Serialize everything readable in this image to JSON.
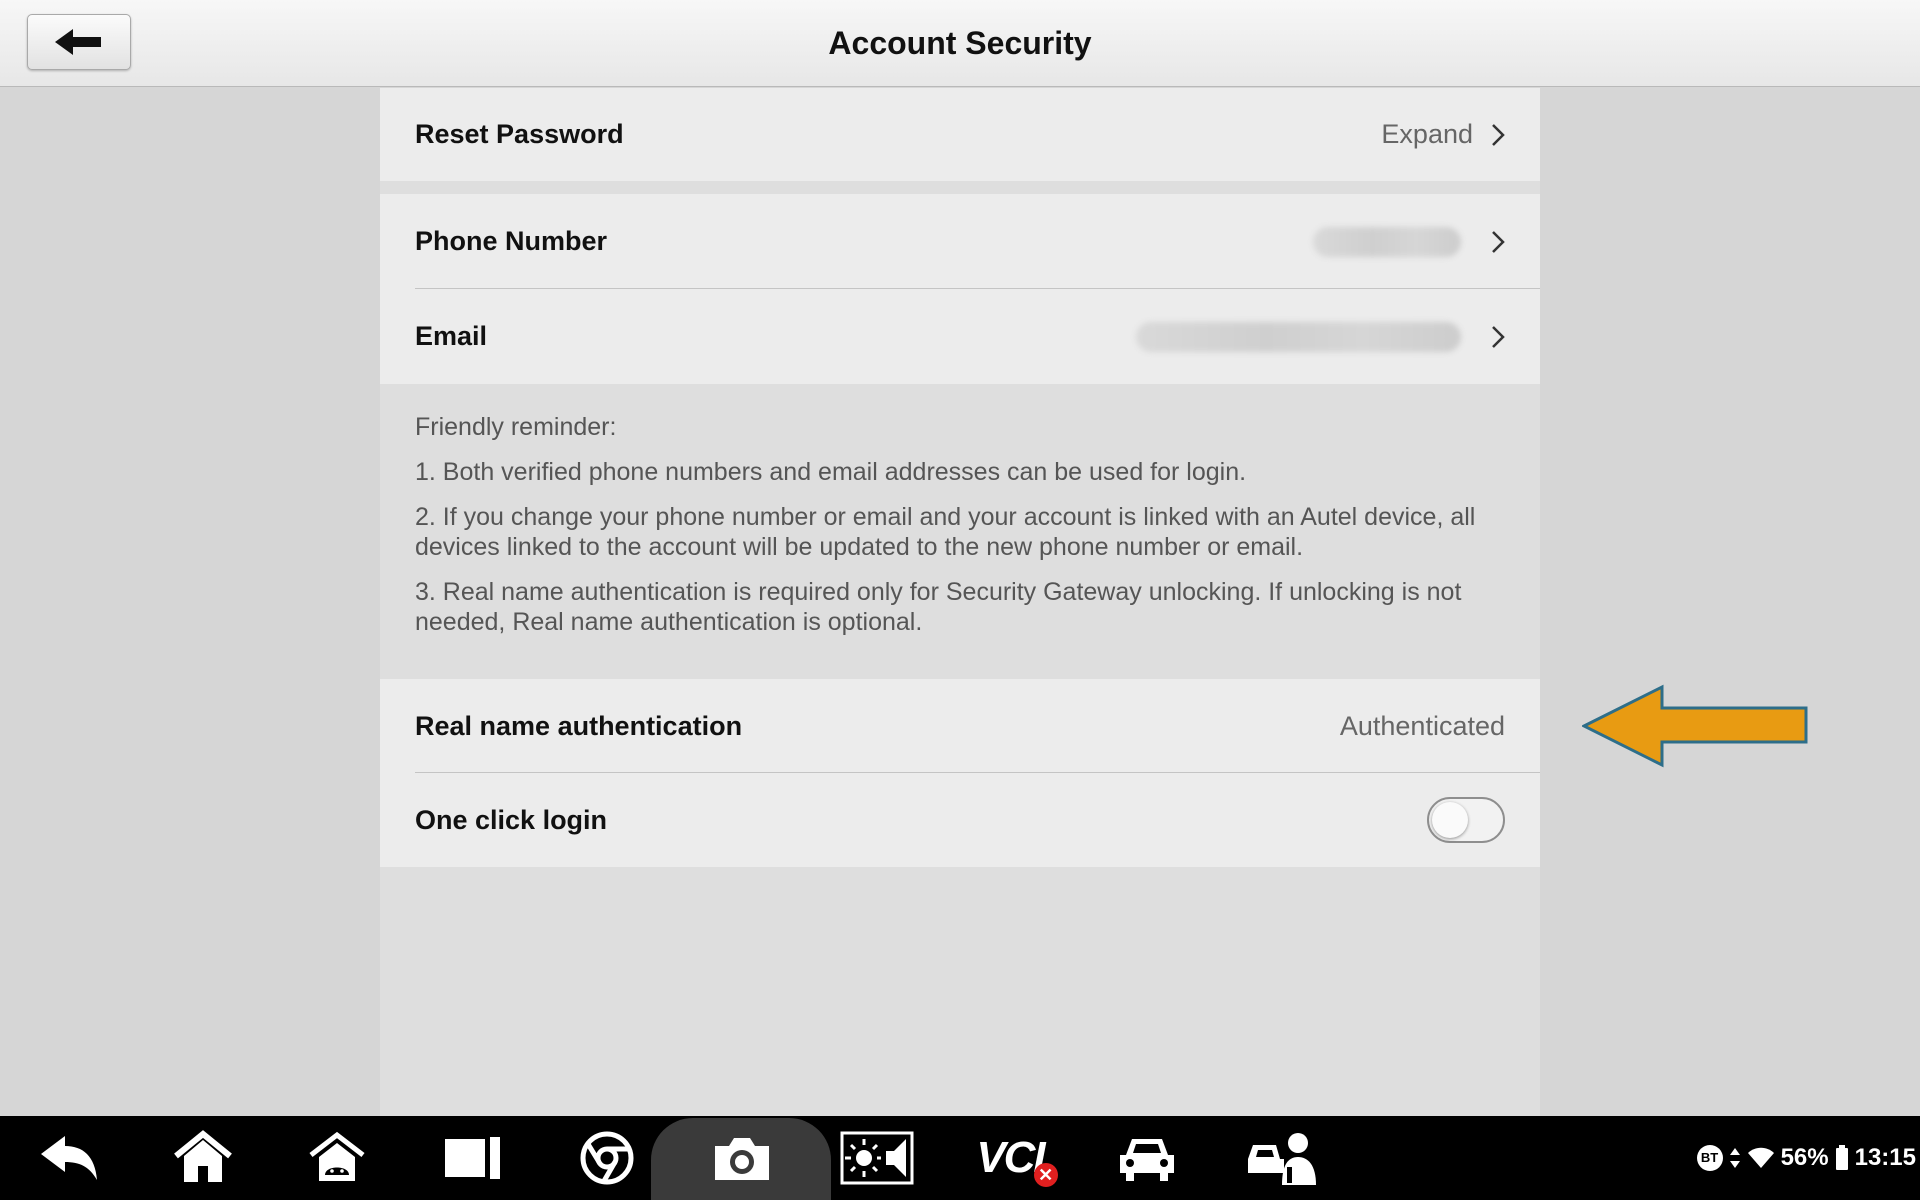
{
  "header": {
    "title": "Account Security"
  },
  "rows": {
    "reset_password": {
      "label": "Reset Password",
      "value": "Expand"
    },
    "phone_number": {
      "label": "Phone Number"
    },
    "email": {
      "label": "Email"
    },
    "real_name": {
      "label": "Real name authentication",
      "value": "Authenticated"
    },
    "one_click_login": {
      "label": "One click login",
      "enabled": false
    }
  },
  "reminder": {
    "title": "Friendly reminder:",
    "items": [
      "1. Both verified phone numbers and email addresses can be used for login.",
      "2. If you change your phone number or email and your account is linked with an Autel device, all devices linked to the account will be updated to the new phone number or email.",
      "3. Real name authentication is required only for Security Gateway unlocking. If unlocking is not needed, Real name authentication is optional."
    ]
  },
  "annotation": {
    "arrow_color": "#e89b12",
    "arrow_outline": "#2d6e8a"
  },
  "taskbar": {
    "icons": [
      "back-arrow-icon",
      "home-icon",
      "house-android-icon",
      "tablet-icon",
      "chrome-icon",
      "camera-icon",
      "brightness-volume-icon",
      "vci-status-icon",
      "car-icon",
      "technician-icon"
    ],
    "vci_label": "VCI"
  },
  "status_bar": {
    "bluetooth": "BT",
    "battery": "56%",
    "time": "13:15"
  }
}
